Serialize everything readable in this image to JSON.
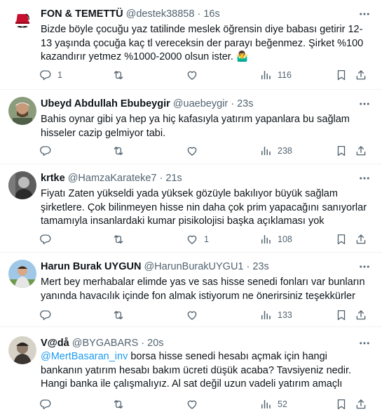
{
  "tweets": [
    {
      "name": "FON & TEMETTÜ",
      "handle": "@destek38858",
      "dot": "·",
      "time": "16s",
      "text": "Bizde böyle çocuğu yaz tatilinde meslek öğrensin diye babası getirir 12-13 yaşında çocuğa kaç tl vereceksin der parayı beğenmez. Şirket %100 kazandırır yetmez %1000-2000 olsun ister. 🤷‍♂️",
      "mention": "",
      "replies": "1",
      "retweets": "",
      "likes": "",
      "views": "116"
    },
    {
      "name": "Ubeyd Abdullah Ebubeygir",
      "handle": "@uaebeygir",
      "dot": "·",
      "time": "23s",
      "text": "Bahis oynar gibi ya hep ya hiç kafasıyla yatırım yapanlara bu sağlam hisseler cazip gelmiyor tabi.",
      "mention": "",
      "replies": "",
      "retweets": "",
      "likes": "",
      "views": "238"
    },
    {
      "name": "krtke",
      "handle": "@HamzaKarateke7",
      "dot": "·",
      "time": "21s",
      "text": "Fiyatı Zaten yükseldi yada yüksek gözüyle bakılıyor büyük sağlam şirketlere. Çok bilinmeyen hisse nin daha çok prim yapacağını sanıyorlar tamamıyla insanlardaki kumar pisikolojisi başka açıklaması yok",
      "mention": "",
      "replies": "",
      "retweets": "",
      "likes": "1",
      "views": "108"
    },
    {
      "name": "Harun Burak UYGUN",
      "handle": "@HarunBurakUYGU1",
      "dot": "·",
      "time": "23s",
      "text": "Mert bey merhabalar elimde yas ve sas hisse senedi fonları var bunların yanında havacılık içinde fon almak istiyorum ne önerirsiniz teşekkürler",
      "mention": "",
      "replies": "",
      "retweets": "",
      "likes": "",
      "views": "133"
    },
    {
      "name": "V@då",
      "handle": "@BYGABARS",
      "dot": "·",
      "time": "20s",
      "text": " borsa hisse senedi hesabı açmak için hangi bankanın yatırım hesabı bakım ücreti düşük acaba? Tavsiyeniz nedir. Hangi banka ile çalışmalıyız. Al sat değil uzun vadeli yatırım amaçlı",
      "mention": "@MertBasaran_inv",
      "replies": "",
      "retweets": "",
      "likes": "",
      "views": "52"
    }
  ],
  "colors": {
    "text": "#0f1419",
    "secondary": "#536471",
    "link": "#1d9bf0",
    "divider": "#eff3f4"
  },
  "icons": [
    "fez-logo-icon",
    "more-icon",
    "reply-icon",
    "retweet-icon",
    "like-icon",
    "views-icon",
    "bookmark-icon",
    "share-icon"
  ]
}
